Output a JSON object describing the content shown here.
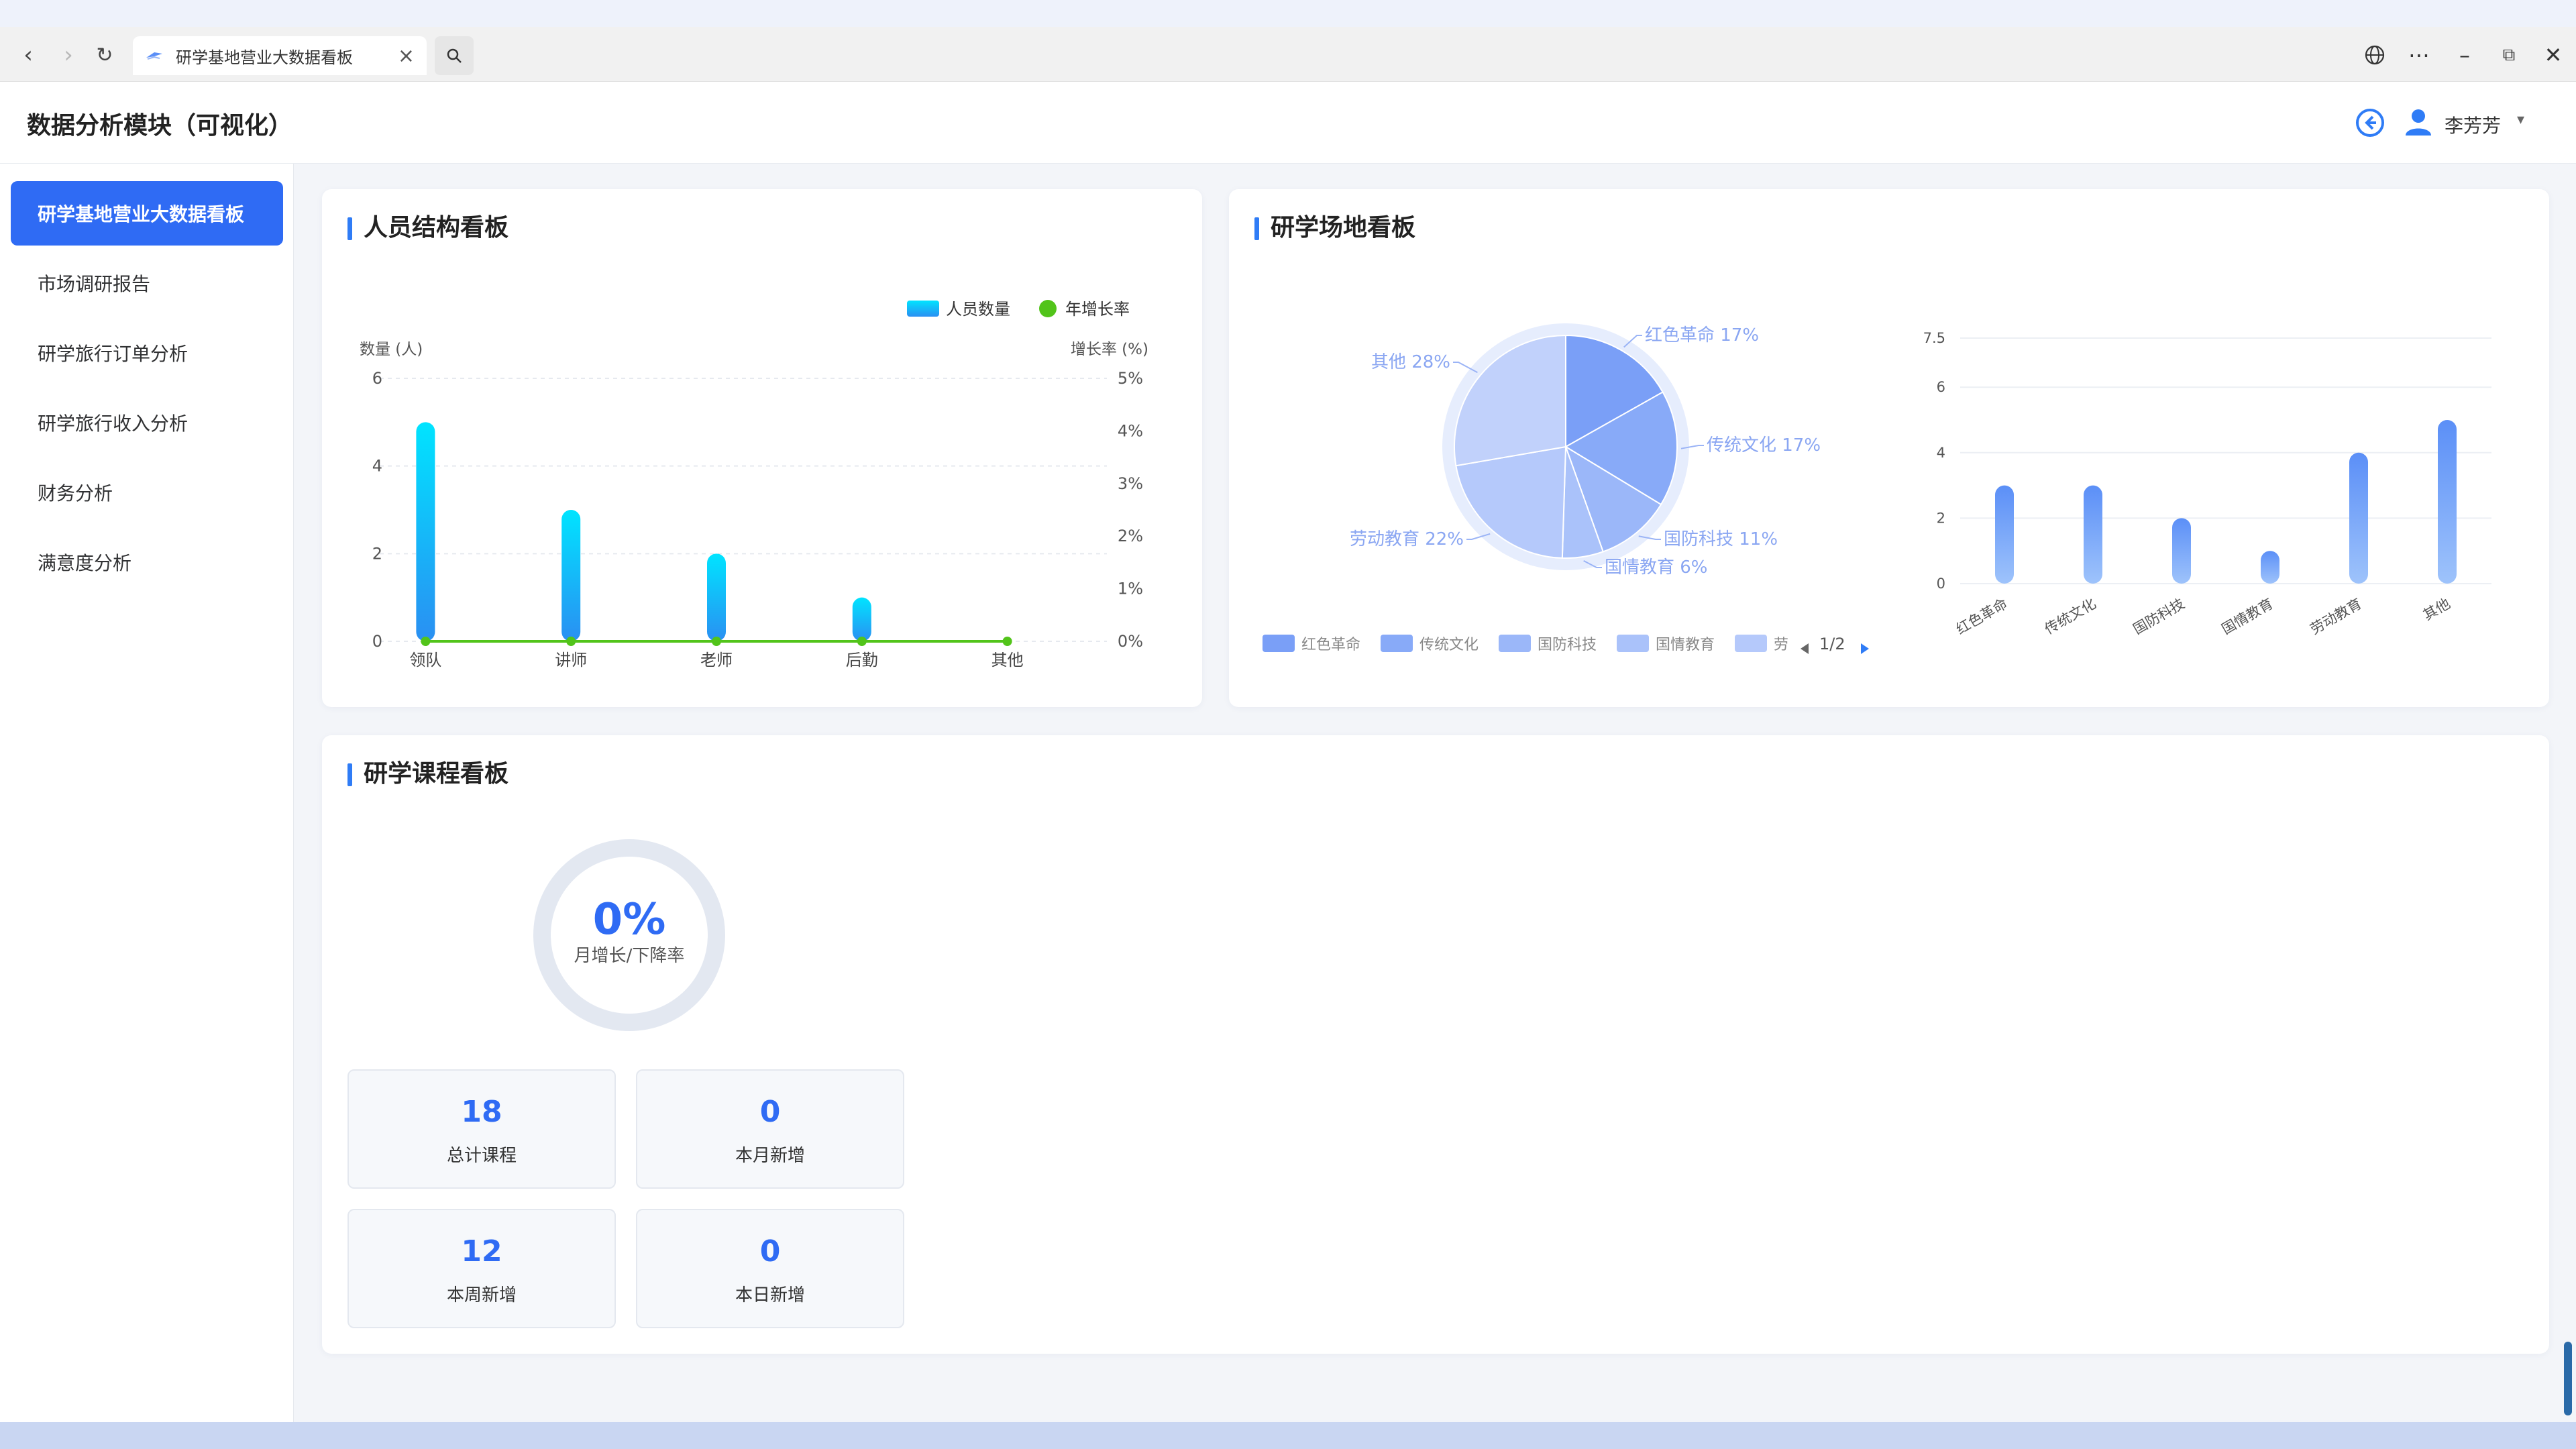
{
  "browser": {
    "tab_title": "研学基地营业大数据看板",
    "back_icon": "arrow-left-icon",
    "forward_icon": "arrow-right-icon",
    "reload_icon": "reload-icon",
    "search_icon": "search-icon",
    "globe_icon": "globe-icon"
  },
  "header": {
    "title": "数据分析模块（可视化）",
    "user_name": "李芳芳"
  },
  "sidebar": {
    "items": [
      {
        "label": "研学基地营业大数据看板",
        "active": true
      },
      {
        "label": "市场调研报告",
        "active": false
      },
      {
        "label": "研学旅行订单分析",
        "active": false
      },
      {
        "label": "研学旅行收入分析",
        "active": false
      },
      {
        "label": "财务分析",
        "active": false
      },
      {
        "label": "满意度分析",
        "active": false
      }
    ]
  },
  "personnel": {
    "title": "人员结构看板",
    "chart_data": {
      "type": "bar",
      "categories": [
        "领队",
        "讲师",
        "老师",
        "后勤",
        "其他"
      ],
      "series": [
        {
          "name": "人员数量",
          "values": [
            5,
            3,
            2,
            1,
            0
          ]
        },
        {
          "name": "年增长率",
          "values": [
            0,
            0,
            0,
            0,
            0
          ]
        }
      ],
      "ylabel": "数量 (人)",
      "y2label": "增长率 (%)",
      "yticks": [
        "0",
        "2",
        "4",
        "6"
      ],
      "y2ticks": [
        "0%",
        "1%",
        "2%",
        "3%",
        "4%",
        "5%"
      ],
      "ylim": [
        0,
        6
      ],
      "y2lim": [
        0,
        5
      ],
      "legend": "top-right",
      "colors": {
        "bar_top": "#00e4ff",
        "bar_bottom": "#2a8ff2",
        "line": "#52c41a"
      }
    }
  },
  "venue": {
    "title": "研学场地看板",
    "pie_data": {
      "type": "pie",
      "slices": [
        {
          "name": "红色革命",
          "percent": 17,
          "label": "红色革命  17%",
          "color": "#7a9ff7"
        },
        {
          "name": "传统文化",
          "percent": 17,
          "label": "传统文化  17%",
          "color": "#88aaf8"
        },
        {
          "name": "国防科技",
          "percent": 11,
          "label": "国防科技  11%",
          "color": "#9bb7f9"
        },
        {
          "name": "国情教育",
          "percent": 6,
          "label": "国情教育  6%",
          "color": "#aac2fa"
        },
        {
          "name": "劳动教育",
          "percent": 22,
          "label": "劳动教育  22%",
          "color": "#b5c9fb"
        },
        {
          "name": "其他",
          "percent": 28,
          "label": "其他  28%",
          "color": "#c1d1fb"
        }
      ],
      "legend_items": [
        "红色革命",
        "传统文化",
        "国防科技",
        "国情教育",
        "劳"
      ],
      "legend_page": "1/2"
    },
    "bar_data": {
      "type": "bar",
      "categories": [
        "红色革命",
        "传统文化",
        "国防科技",
        "国情教育",
        "劳动教育",
        "其他"
      ],
      "values": [
        3,
        3,
        2,
        1,
        4,
        5
      ],
      "ylim": [
        0,
        7.5
      ],
      "yticks": [
        "0",
        "2",
        "4",
        "6",
        "7.5"
      ],
      "colors": {
        "bar_top": "#5b8ff7",
        "bar_bottom": "#9ec3fb"
      }
    }
  },
  "course": {
    "title": "研学课程看板",
    "ring_value": "0%",
    "ring_label": "月增长/下降率",
    "stats": [
      {
        "value": "18",
        "label": "总计课程"
      },
      {
        "value": "0",
        "label": "本月新增"
      },
      {
        "value": "12",
        "label": "本周新增"
      },
      {
        "value": "0",
        "label": "本日新增"
      }
    ]
  }
}
